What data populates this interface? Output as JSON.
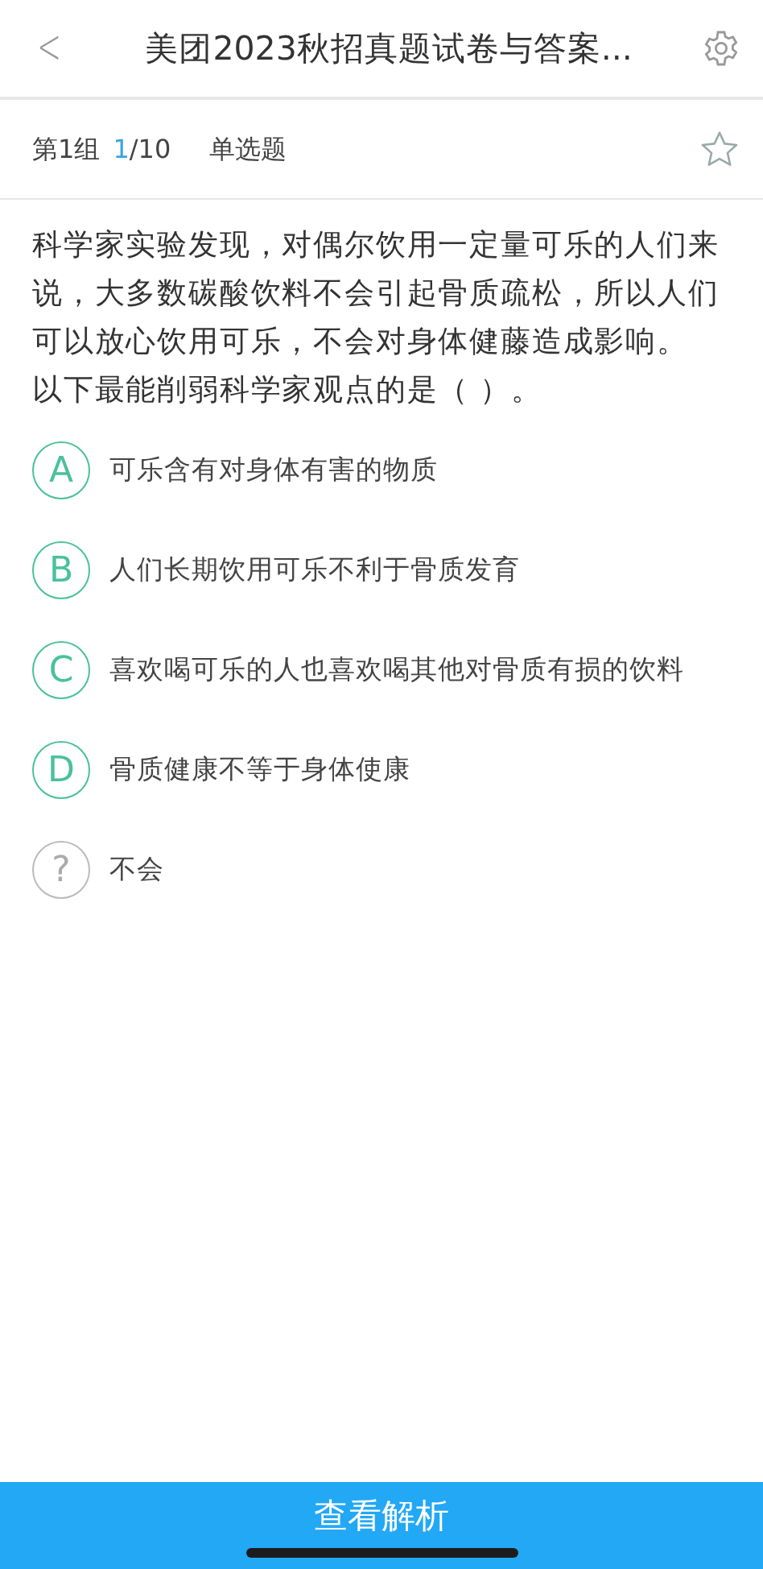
{
  "header": {
    "back": "<",
    "title": "美团2023秋招真题试卷与答案..."
  },
  "info": {
    "group": "第1组",
    "current": "1",
    "total": "/10",
    "type": "单选题",
    "starred": false
  },
  "question": {
    "stem": "科学家实验发现，对偶尔饮用一定量可乐的人们来说，大多数碳酸饮料不会引起骨质疏松，所以人们可以放心饮用可乐，不会对身体健藤造成影响。",
    "prompt": "以下最能削弱科学家观点的是（ ）。"
  },
  "options": [
    {
      "kind": "letter",
      "mark": "A",
      "text": "可乐含有对身体有害的物质",
      "selected": false
    },
    {
      "kind": "letter",
      "mark": "B",
      "text": "人们长期饮用可乐不利于骨质发育",
      "selected": false
    },
    {
      "kind": "letter",
      "mark": "C",
      "text": "喜欢喝可乐的人也喜欢喝其他对骨质有损的饮料",
      "selected": false
    },
    {
      "kind": "letter",
      "mark": "D",
      "text": "骨质健康不等于身体使康",
      "selected": false
    },
    {
      "kind": "unknown",
      "mark": "?",
      "text": "不会",
      "selected": false
    }
  ],
  "footer": {
    "button": "查看解析"
  }
}
